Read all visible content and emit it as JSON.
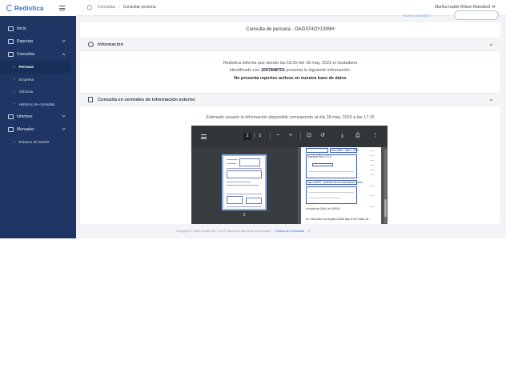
{
  "brand": {
    "name": "Redistica"
  },
  "sidebar": {
    "items": [
      {
        "label": "Inicio"
      },
      {
        "label": "Reportes"
      },
      {
        "label": "Consultas"
      },
      {
        "label": "Persona"
      },
      {
        "label": "Empresa"
      },
      {
        "label": "Vehículo"
      },
      {
        "label": "Histórico de consultas"
      },
      {
        "label": "Informes"
      },
      {
        "label": "Manuales"
      },
      {
        "label": "Enlaces de interés"
      }
    ]
  },
  "topbar": {
    "breadcrumb": {
      "parent": "Consultas",
      "separator": "/",
      "current": "Consultar persona"
    },
    "user": "Martha Isabel Wilson Maruland",
    "faded_link": "Nueva consulta ↺"
  },
  "main": {
    "title": "Consulta de persona - OAG374OY1309H",
    "info_section": {
      "heading": "Información",
      "line1": "Redistica informa que siendo las 18:20 del 18 may. 2023 el ciudadano",
      "line2_prefix": "identificado con",
      "document_number": "1007848701",
      "line2_suffix": "presenta la siguiente información:",
      "line3": "No presenta reportes activos en nuestra base de datos"
    },
    "external_section": {
      "heading": "Consulta en centrales de información externo",
      "note": "Estimado usuario la información disponible corresponde al día 18 may. 2023 a las 17:15"
    }
  },
  "pdf_viewer": {
    "current_page": "2",
    "separator": "/",
    "total_pages": "3",
    "thumbnail_label": "2",
    "doc_texts": [
      "ano 1966 = abril 1 1999",
      "resultado Reo 13 0 0",
      "eau a MIGO - Advierte De sin informacion previa",
      "e inscrita en DIAN, de 2/05/04",
      "ne, informacion de Registro ASNII bajo el art 1 Base de..."
    ]
  },
  "footer": {
    "copyright": "Copyright © 2023 Grupo DET S.A.S Todos los derechos reservados",
    "separator": "|",
    "privacy_link": "Política de privacidad"
  }
}
